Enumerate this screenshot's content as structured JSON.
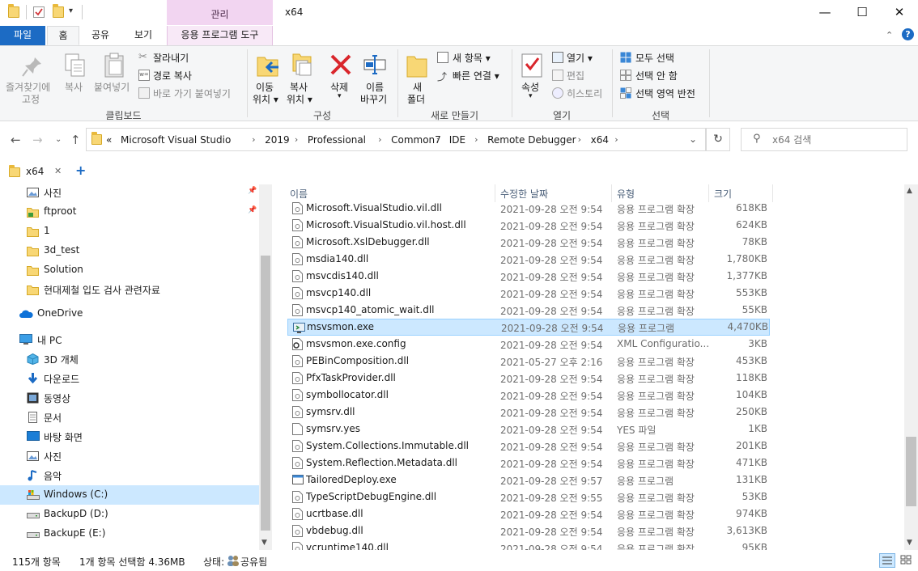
{
  "window": {
    "title": "x64",
    "context_tab": "관리",
    "minimize": "—",
    "maximize": "☐",
    "close": "✕"
  },
  "ribbon_tabs": {
    "file": "파일",
    "home": "홈",
    "share": "공유",
    "view": "보기",
    "app_tools": "응용 프로그램 도구"
  },
  "ribbon": {
    "clipboard": {
      "pin_l1": "즐겨찾기에",
      "pin_l2": "고정",
      "copy": "복사",
      "paste": "붙여넣기",
      "cut": "잘라내기",
      "copy_path": "경로 복사",
      "paste_shortcut": "바로 가기 붙여넣기",
      "label": "클립보드"
    },
    "organize": {
      "move_l1": "이동",
      "move_l2": "위치",
      "copy_l1": "복사",
      "copy_l2": "위치",
      "delete": "삭제",
      "rename_l1": "이름",
      "rename_l2": "바꾸기",
      "label": "구성"
    },
    "new": {
      "folder_l1": "새",
      "folder_l2": "폴더",
      "new_item": "새 항목",
      "easy_access": "빠른 연결",
      "label": "새로 만들기"
    },
    "open": {
      "properties": "속성",
      "open": "열기",
      "edit": "편집",
      "history": "히스토리",
      "label": "열기"
    },
    "select": {
      "select_all": "모두 선택",
      "select_none": "선택 안 함",
      "invert": "선택 영역 반전",
      "label": "선택"
    }
  },
  "address": {
    "overflow": "«",
    "crumbs": [
      "Microsoft Visual Studio",
      "2019",
      "Professional",
      "Common7",
      "IDE",
      "Remote Debugger",
      "x64"
    ],
    "search_placeholder": "x64 검색"
  },
  "folder_tab": {
    "label": "x64",
    "add": "+"
  },
  "nav": [
    {
      "label": "사진",
      "icon": "pictures-icon",
      "pinned": true
    },
    {
      "label": "ftproot",
      "icon": "folder-link-icon",
      "pinned": true
    },
    {
      "label": "1",
      "icon": "folder-icon"
    },
    {
      "label": "3d_test",
      "icon": "folder-icon"
    },
    {
      "label": "Solution",
      "icon": "folder-icon"
    },
    {
      "label": "현대제철 입도 검사 관련자료",
      "icon": "folder-icon"
    },
    {
      "label": "OneDrive",
      "icon": "onedrive-icon"
    },
    {
      "label": "내 PC",
      "icon": "pc-icon"
    },
    {
      "label": "3D 개체",
      "icon": "3d-objects-icon"
    },
    {
      "label": "다운로드",
      "icon": "downloads-icon"
    },
    {
      "label": "동영상",
      "icon": "videos-icon"
    },
    {
      "label": "문서",
      "icon": "documents-icon"
    },
    {
      "label": "바탕 화면",
      "icon": "desktop-icon"
    },
    {
      "label": "사진",
      "icon": "pictures-icon"
    },
    {
      "label": "음악",
      "icon": "music-icon"
    },
    {
      "label": "Windows (C:)",
      "icon": "drive-c-icon",
      "selected": true
    },
    {
      "label": "BackupD (D:)",
      "icon": "drive-icon"
    },
    {
      "label": "BackupE (E:)",
      "icon": "drive-icon"
    }
  ],
  "columns": {
    "name": "이름",
    "date": "수정한 날짜",
    "type": "유형",
    "size": "크기"
  },
  "files": [
    {
      "name": "Microsoft.VisualStudio.vil.dll",
      "date": "2021-09-28 오전 9:54",
      "type": "응용 프로그램 확장",
      "size": "618KB",
      "icon": "dll"
    },
    {
      "name": "Microsoft.VisualStudio.vil.host.dll",
      "date": "2021-09-28 오전 9:54",
      "type": "응용 프로그램 확장",
      "size": "624KB",
      "icon": "dll"
    },
    {
      "name": "Microsoft.XslDebugger.dll",
      "date": "2021-09-28 오전 9:54",
      "type": "응용 프로그램 확장",
      "size": "78KB",
      "icon": "dll"
    },
    {
      "name": "msdia140.dll",
      "date": "2021-09-28 오전 9:54",
      "type": "응용 프로그램 확장",
      "size": "1,780KB",
      "icon": "dll"
    },
    {
      "name": "msvcdis140.dll",
      "date": "2021-09-28 오전 9:54",
      "type": "응용 프로그램 확장",
      "size": "1,377KB",
      "icon": "dll"
    },
    {
      "name": "msvcp140.dll",
      "date": "2021-09-28 오전 9:54",
      "type": "응용 프로그램 확장",
      "size": "553KB",
      "icon": "dll"
    },
    {
      "name": "msvcp140_atomic_wait.dll",
      "date": "2021-09-28 오전 9:54",
      "type": "응용 프로그램 확장",
      "size": "55KB",
      "icon": "dll"
    },
    {
      "name": "msvsmon.exe",
      "date": "2021-09-28 오전 9:54",
      "type": "응용 프로그램",
      "size": "4,470KB",
      "icon": "exe-monitor",
      "selected": true
    },
    {
      "name": "msvsmon.exe.config",
      "date": "2021-09-28 오전 9:54",
      "type": "XML Configuratio...",
      "size": "3KB",
      "icon": "config"
    },
    {
      "name": "PEBinComposition.dll",
      "date": "2021-05-27 오후 2:16",
      "type": "응용 프로그램 확장",
      "size": "453KB",
      "icon": "dll"
    },
    {
      "name": "PfxTaskProvider.dll",
      "date": "2021-09-28 오전 9:54",
      "type": "응용 프로그램 확장",
      "size": "118KB",
      "icon": "dll"
    },
    {
      "name": "symbollocator.dll",
      "date": "2021-09-28 오전 9:54",
      "type": "응용 프로그램 확장",
      "size": "104KB",
      "icon": "dll"
    },
    {
      "name": "symsrv.dll",
      "date": "2021-09-28 오전 9:54",
      "type": "응용 프로그램 확장",
      "size": "250KB",
      "icon": "dll"
    },
    {
      "name": "symsrv.yes",
      "date": "2021-09-28 오전 9:54",
      "type": "YES 파일",
      "size": "1KB",
      "icon": "file"
    },
    {
      "name": "System.Collections.Immutable.dll",
      "date": "2021-09-28 오전 9:54",
      "type": "응용 프로그램 확장",
      "size": "201KB",
      "icon": "dll"
    },
    {
      "name": "System.Reflection.Metadata.dll",
      "date": "2021-09-28 오전 9:54",
      "type": "응용 프로그램 확장",
      "size": "471KB",
      "icon": "dll"
    },
    {
      "name": "TailoredDeploy.exe",
      "date": "2021-09-28 오전 9:57",
      "type": "응용 프로그램",
      "size": "131KB",
      "icon": "exe"
    },
    {
      "name": "TypeScriptDebugEngine.dll",
      "date": "2021-09-28 오전 9:55",
      "type": "응용 프로그램 확장",
      "size": "53KB",
      "icon": "dll"
    },
    {
      "name": "ucrtbase.dll",
      "date": "2021-09-28 오전 9:54",
      "type": "응용 프로그램 확장",
      "size": "974KB",
      "icon": "dll"
    },
    {
      "name": "vbdebug.dll",
      "date": "2021-09-28 오전 9:54",
      "type": "응용 프로그램 확장",
      "size": "3,613KB",
      "icon": "dll"
    },
    {
      "name": "vcruntime140.dll",
      "date": "2021-09-28 오전 9:54",
      "type": "응용 프로그램 확장",
      "size": "95KB",
      "icon": "dll"
    }
  ],
  "status": {
    "count": "115개 항목",
    "selection": "1개 항목 선택함 4.36MB",
    "state_label": "상태:",
    "state_value": "공유됨"
  },
  "colors": {
    "accent": "#1c6bc4",
    "selection": "#cce8ff",
    "context_tab": "#f2d5f1"
  }
}
